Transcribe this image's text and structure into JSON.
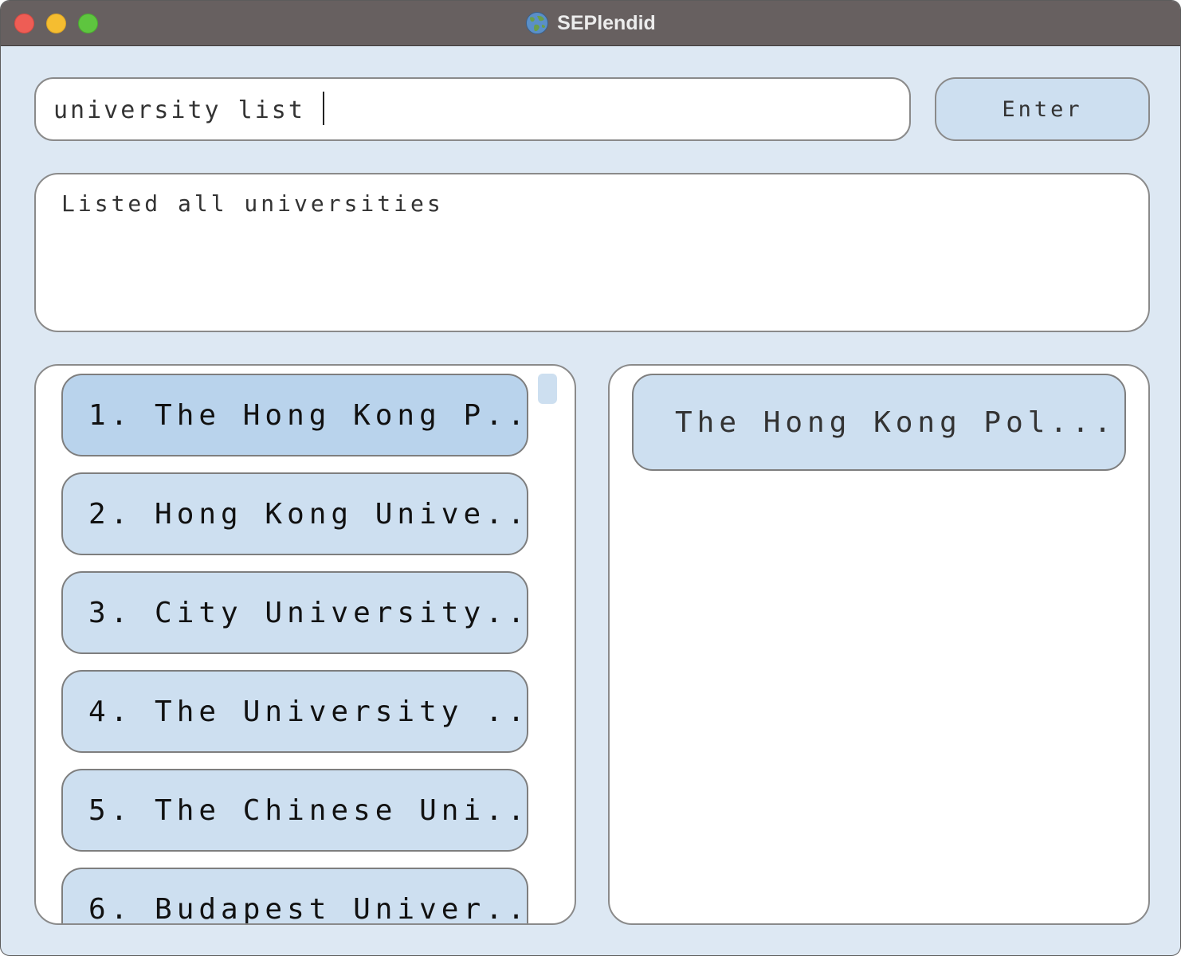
{
  "window": {
    "title": "SEPlendid"
  },
  "command": {
    "input_value": "university list",
    "enter_label": "Enter"
  },
  "result": {
    "message": "Listed all universities"
  },
  "university_list": {
    "items": [
      {
        "label": "1. The Hong Kong P..."
      },
      {
        "label": "2. Hong Kong Unive..."
      },
      {
        "label": "3. City University..."
      },
      {
        "label": "4. The University ..."
      },
      {
        "label": "5. The Chinese Uni..."
      },
      {
        "label": "6. Budapest Univer..."
      }
    ]
  },
  "detail_panel": {
    "items": [
      {
        "label": "The Hong Kong Pol..."
      }
    ]
  },
  "colors": {
    "window_bg": "#dde8f3",
    "titlebar": "#676060",
    "card": "#cddff0",
    "card_selected": "#b9d3ec"
  },
  "icons": {
    "app": "globe-icon"
  }
}
